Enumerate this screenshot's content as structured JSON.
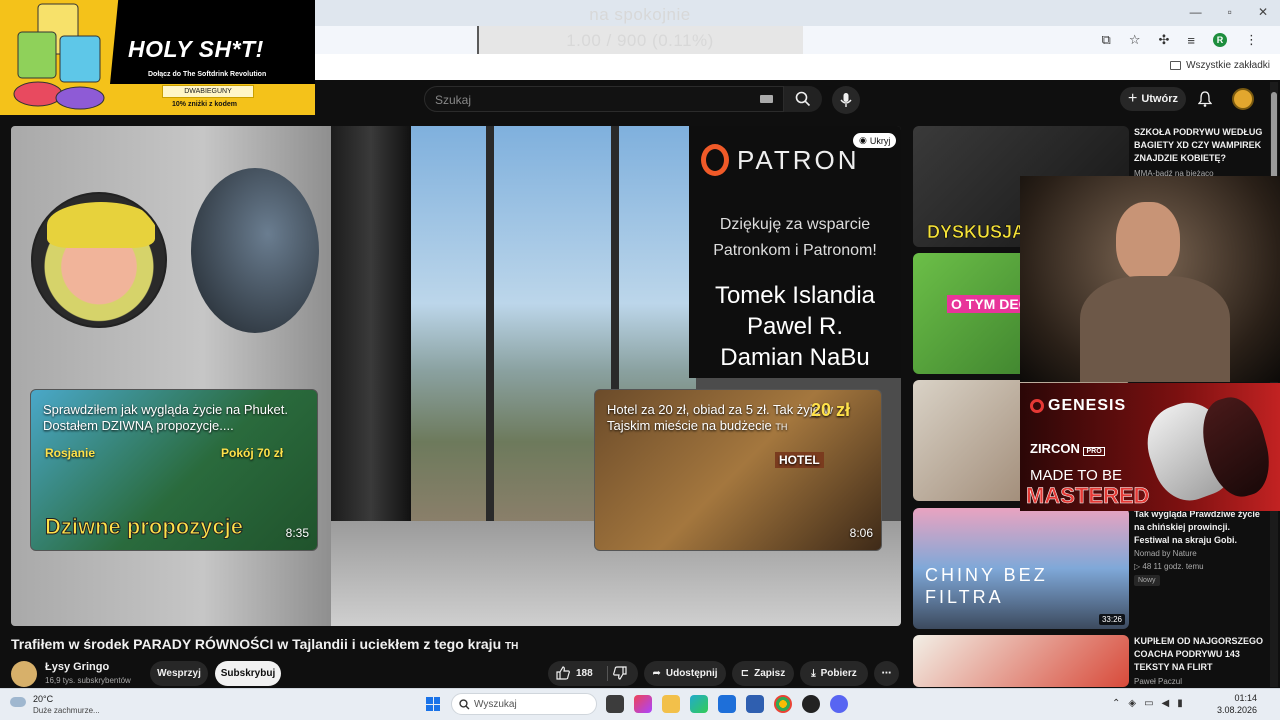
{
  "overlay": {
    "line1": "na spokojnie",
    "line2": "1.00 / 900 (0.11%)"
  },
  "browser": {
    "bookmarks_label": "Wszystkie zakładki",
    "profile_initial": "R"
  },
  "ad": {
    "title": "HOLY SH*T!",
    "subtitle": "Dołącz do The Softdrink Revolution",
    "code": "DWABIEGUNY",
    "note": "10% zniżki z kodem"
  },
  "header": {
    "search_placeholder": "Szukaj",
    "create_label": "Utwórz"
  },
  "player": {
    "patron_name": "PATRON",
    "patron_thanks_1": "Dziękuję za wsparcie",
    "patron_thanks_2": "Patronkom i Patronom!",
    "patron_names": [
      "Tomek Islandia",
      "Pawel R.",
      "Damian NaBu"
    ],
    "hide_label": "Ukryj",
    "endcards": [
      {
        "title": "Sprawdziłem jak wygląda życie na Phuket. Dostałem DZIWNĄ propozycje....",
        "caption": "Dziwne propozycje",
        "tag1": "Rosjanie",
        "tag2": "Pokój 70 zł",
        "duration": "8:35"
      },
      {
        "title": "Hotel za 20 zł, obiad za 5 zł. Tak żyję w Tajskim mieście na budżecie",
        "title_suffix": "TH",
        "tag1": "20 zł",
        "tag2": "HOTEL",
        "duration": "8:06"
      }
    ]
  },
  "video": {
    "title": "Trafiłem w środek PARADY RÓWNOŚCI w Tajlandii i uciekłem z tego kraju",
    "title_suffix": "TH",
    "channel": "Łysy Gringo",
    "subscribers": "16,9 tys. subskrybentów",
    "support_label": "Wesprzyj",
    "subscribe_label": "Subskrybuj",
    "likes": "188",
    "share_label": "Udostępnij",
    "save_label": "Zapisz",
    "download_label": "Pobierz"
  },
  "recommendations": [
    {
      "title": "SZKOŁA PODRYWU WEDŁUG BAGIETY XD CZY WAMPIREK ZNAJDZIE KOBIETĘ?",
      "channel": "MMA-bądź na bieżąco",
      "thumb_text": "DYSKUSJA"
    },
    {
      "title": "",
      "channel": "",
      "thumb_text": "O TYM DEC"
    },
    {
      "title": "",
      "channel": "",
      "thumb_text": ""
    },
    {
      "title": "Tak wygląda Prawdziwe życie na chińskiej prowincji. Festiwal na skraju Gobi.",
      "channel": "Nomad by Nature",
      "meta": "▷ 48   11 godz. temu",
      "badge": "Nowy",
      "thumb_text": "CHINY BEZ FILTRA",
      "duration": "33:26"
    },
    {
      "title": "KUPIŁEM OD NAJGORSZEGO COACHA PODRYWU 143 TEKSTY NA FLIRT",
      "channel": "Paweł Paczul",
      "thumb_text": "",
      "duration": ""
    }
  ],
  "genesis_ad": {
    "brand": "GENESIS",
    "model": "ZIRCON",
    "model_tag": "PRO",
    "tagline": "MADE TO BE",
    "tagline2": "MASTERED"
  },
  "taskbar": {
    "temperature": "20°C",
    "weather": "Duże zachmurze...",
    "search_placeholder": "Wyszukaj",
    "time": "01:14",
    "date": "3.08.2026"
  }
}
